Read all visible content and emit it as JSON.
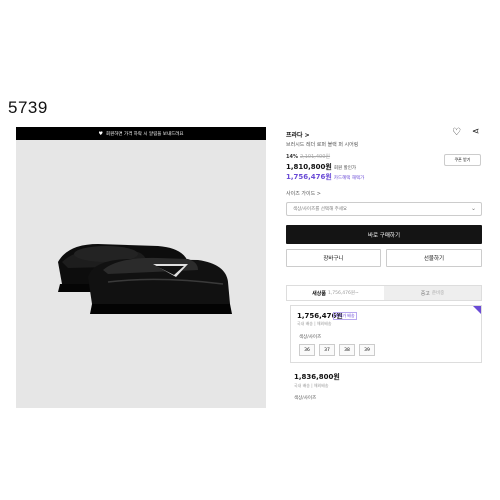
{
  "page_label": "5739",
  "image_panel": {
    "banner_text": "회원하면 가격 하락 시 알림을 보내드려요"
  },
  "product": {
    "brand": "프라다 >",
    "title": "브러시드 레더 로퍼 블랙 퍼 시어링",
    "discount_pct": "14%",
    "original_price": "2,101,400원",
    "price": "1,810,800원",
    "price_note": "회원 할인가",
    "member_price": "1,756,476원",
    "member_price_note": "카드혜택 해택가",
    "coupon_label": "쿠폰 받기"
  },
  "size": {
    "guide_label": "사이즈 가이드 >",
    "select_placeholder": "색상/사이즈를 선택해 주세요"
  },
  "actions": {
    "buy_label": "바로 구매하기",
    "cart_label": "장바구니",
    "gift_label": "선물하기"
  },
  "tabs": [
    {
      "label": "새상품",
      "sub": "1,756,476원~"
    },
    {
      "label": "중고",
      "sub": "준비중"
    }
  ],
  "offers": [
    {
      "price": "1,756,476원",
      "badge": "최저가 배송",
      "seller": "국내 배송 | 해외배송",
      "option_label": "색상/사이즈",
      "sizes": [
        "36",
        "37",
        "38",
        "39"
      ]
    },
    {
      "price": "1,836,800원",
      "seller": "국내 배송 | 해외배송",
      "option_label": "색상/사이즈"
    }
  ],
  "colors": {
    "accent": "#6a4bd6",
    "buy_button": "#141414",
    "image_bg": "#e6e6e6"
  },
  "icons": [
    "heart-icon",
    "share-icon",
    "chevron-down-icon"
  ]
}
